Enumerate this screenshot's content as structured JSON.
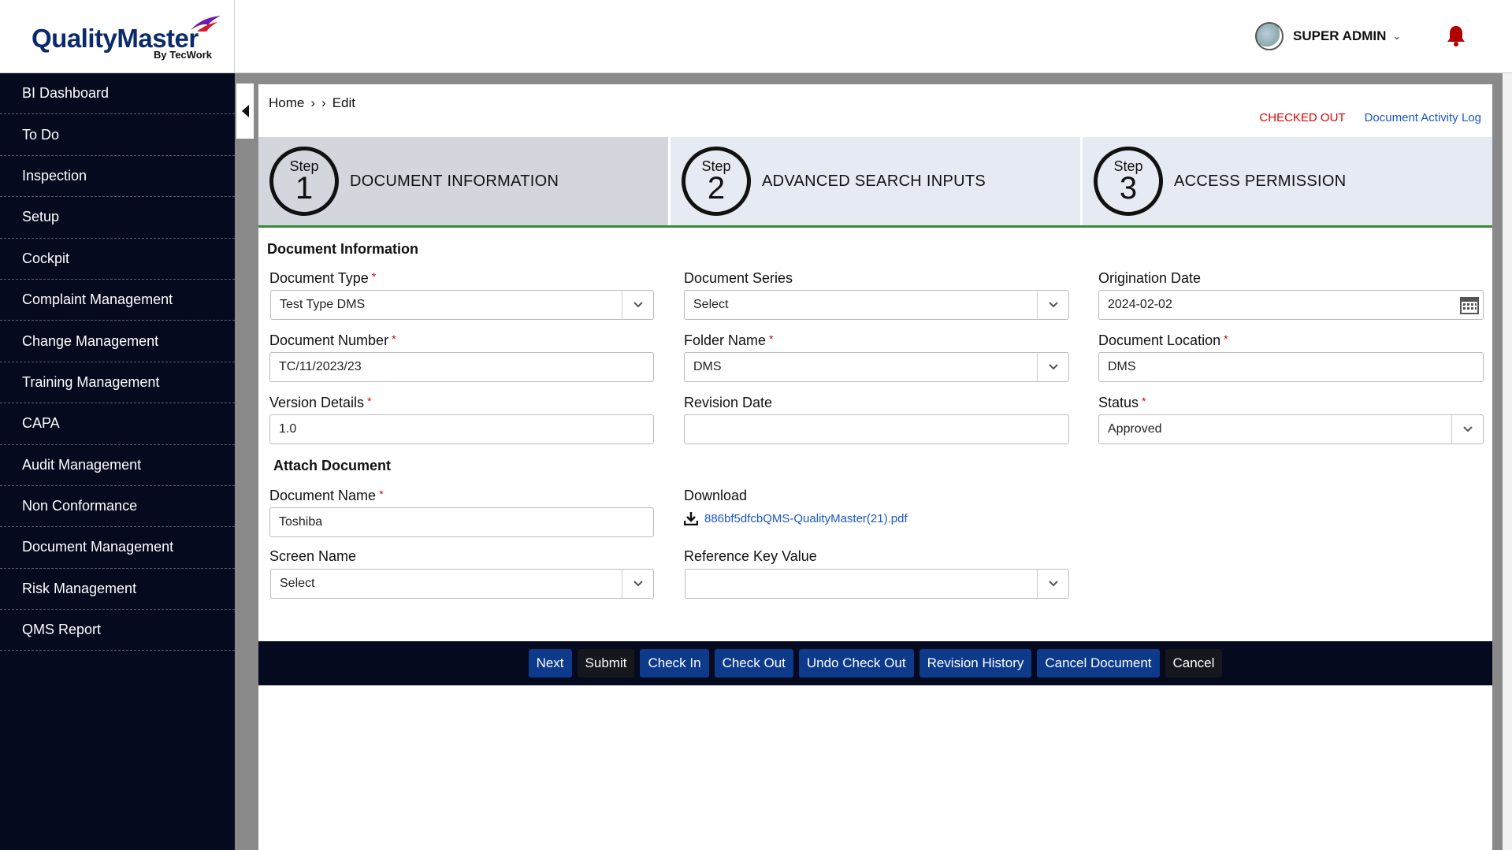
{
  "header": {
    "logo_main": "QualityMaster",
    "logo_sub": "By TecWork",
    "user_name": "SUPER ADMIN"
  },
  "sidebar": {
    "items": [
      {
        "label": "BI Dashboard"
      },
      {
        "label": "To Do"
      },
      {
        "label": "Inspection"
      },
      {
        "label": "Setup"
      },
      {
        "label": "Cockpit"
      },
      {
        "label": "Complaint Management"
      },
      {
        "label": "Change Management"
      },
      {
        "label": "Training Management"
      },
      {
        "label": "CAPA"
      },
      {
        "label": "Audit Management"
      },
      {
        "label": "Non Conformance"
      },
      {
        "label": "Document Management"
      },
      {
        "label": "Risk Management"
      },
      {
        "label": "QMS Report"
      }
    ]
  },
  "breadcrumb": {
    "home": "Home",
    "sep1": "›",
    "sep2": "›",
    "current": "Edit"
  },
  "status": {
    "checked_out": "CHECKED OUT",
    "activity_log": "Document Activity Log"
  },
  "steps": [
    {
      "word": "Step",
      "num": "1",
      "title": "DOCUMENT INFORMATION"
    },
    {
      "word": "Step",
      "num": "2",
      "title": "ADVANCED SEARCH INPUTS"
    },
    {
      "word": "Step",
      "num": "3",
      "title": "ACCESS PERMISSION"
    }
  ],
  "form": {
    "section_title": "Document Information",
    "document_type": {
      "label": "Document Type",
      "value": "Test Type DMS"
    },
    "document_series": {
      "label": "Document Series",
      "value": "Select"
    },
    "origination_date": {
      "label": "Origination Date",
      "value": "2024-02-02"
    },
    "document_number": {
      "label": "Document Number",
      "value": "TC/11/2023/23"
    },
    "folder_name": {
      "label": "Folder Name",
      "value": "DMS"
    },
    "document_location": {
      "label": "Document Location",
      "value": "DMS"
    },
    "version_details": {
      "label": "Version Details",
      "value": "1.0"
    },
    "revision_date": {
      "label": "Revision Date",
      "value": ""
    },
    "status": {
      "label": "Status",
      "value": "Approved"
    },
    "attach_title": "Attach Document",
    "document_name": {
      "label": "Document Name",
      "value": "Toshiba"
    },
    "download": {
      "label": "Download",
      "file": "886bf5dfcbQMS-QualityMaster(21).pdf"
    },
    "screen_name": {
      "label": "Screen Name",
      "value": "Select"
    },
    "reference_key": {
      "label": "Reference Key Value",
      "value": ""
    },
    "required_mark": "*"
  },
  "actions": {
    "next": "Next",
    "submit": "Submit",
    "check_in": "Check In",
    "check_out": "Check Out",
    "undo_check_out": "Undo Check Out",
    "revision_history": "Revision History",
    "cancel_document": "Cancel Document",
    "cancel": "Cancel"
  },
  "colors": {
    "sidebar_bg": "#050a1f",
    "primary_button": "#0d3a8a",
    "checked_out": "#e00000",
    "link": "#1a56c8",
    "step_underline": "#3a8a3a",
    "bell": "#b00000"
  }
}
